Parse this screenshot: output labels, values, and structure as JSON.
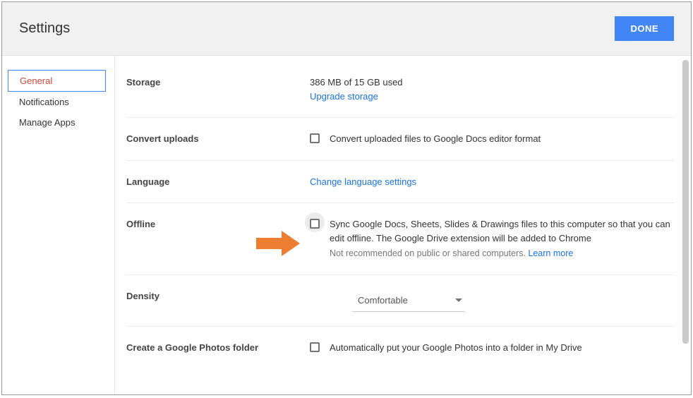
{
  "header": {
    "title": "Settings",
    "done_label": "DONE"
  },
  "sidebar": {
    "items": [
      {
        "label": "General",
        "active": true
      },
      {
        "label": "Notifications",
        "active": false
      },
      {
        "label": "Manage Apps",
        "active": false
      }
    ]
  },
  "sections": {
    "storage": {
      "label": "Storage",
      "used_text": "386 MB of 15 GB used",
      "upgrade_link": "Upgrade storage"
    },
    "convert": {
      "label": "Convert uploads",
      "checkbox_label": "Convert uploaded files to Google Docs editor format"
    },
    "language": {
      "label": "Language",
      "link": "Change language settings"
    },
    "offline": {
      "label": "Offline",
      "checkbox_label": "Sync Google Docs, Sheets, Slides & Drawings files to this computer so that you can edit offline. The Google Drive extension will be added to Chrome",
      "hint": "Not recommended on public or shared computers. ",
      "learn_more": "Learn more"
    },
    "density": {
      "label": "Density",
      "selected": "Comfortable"
    },
    "photos": {
      "label": "Create a Google Photos folder",
      "checkbox_label": "Automatically put your Google Photos into a folder in My Drive"
    }
  }
}
